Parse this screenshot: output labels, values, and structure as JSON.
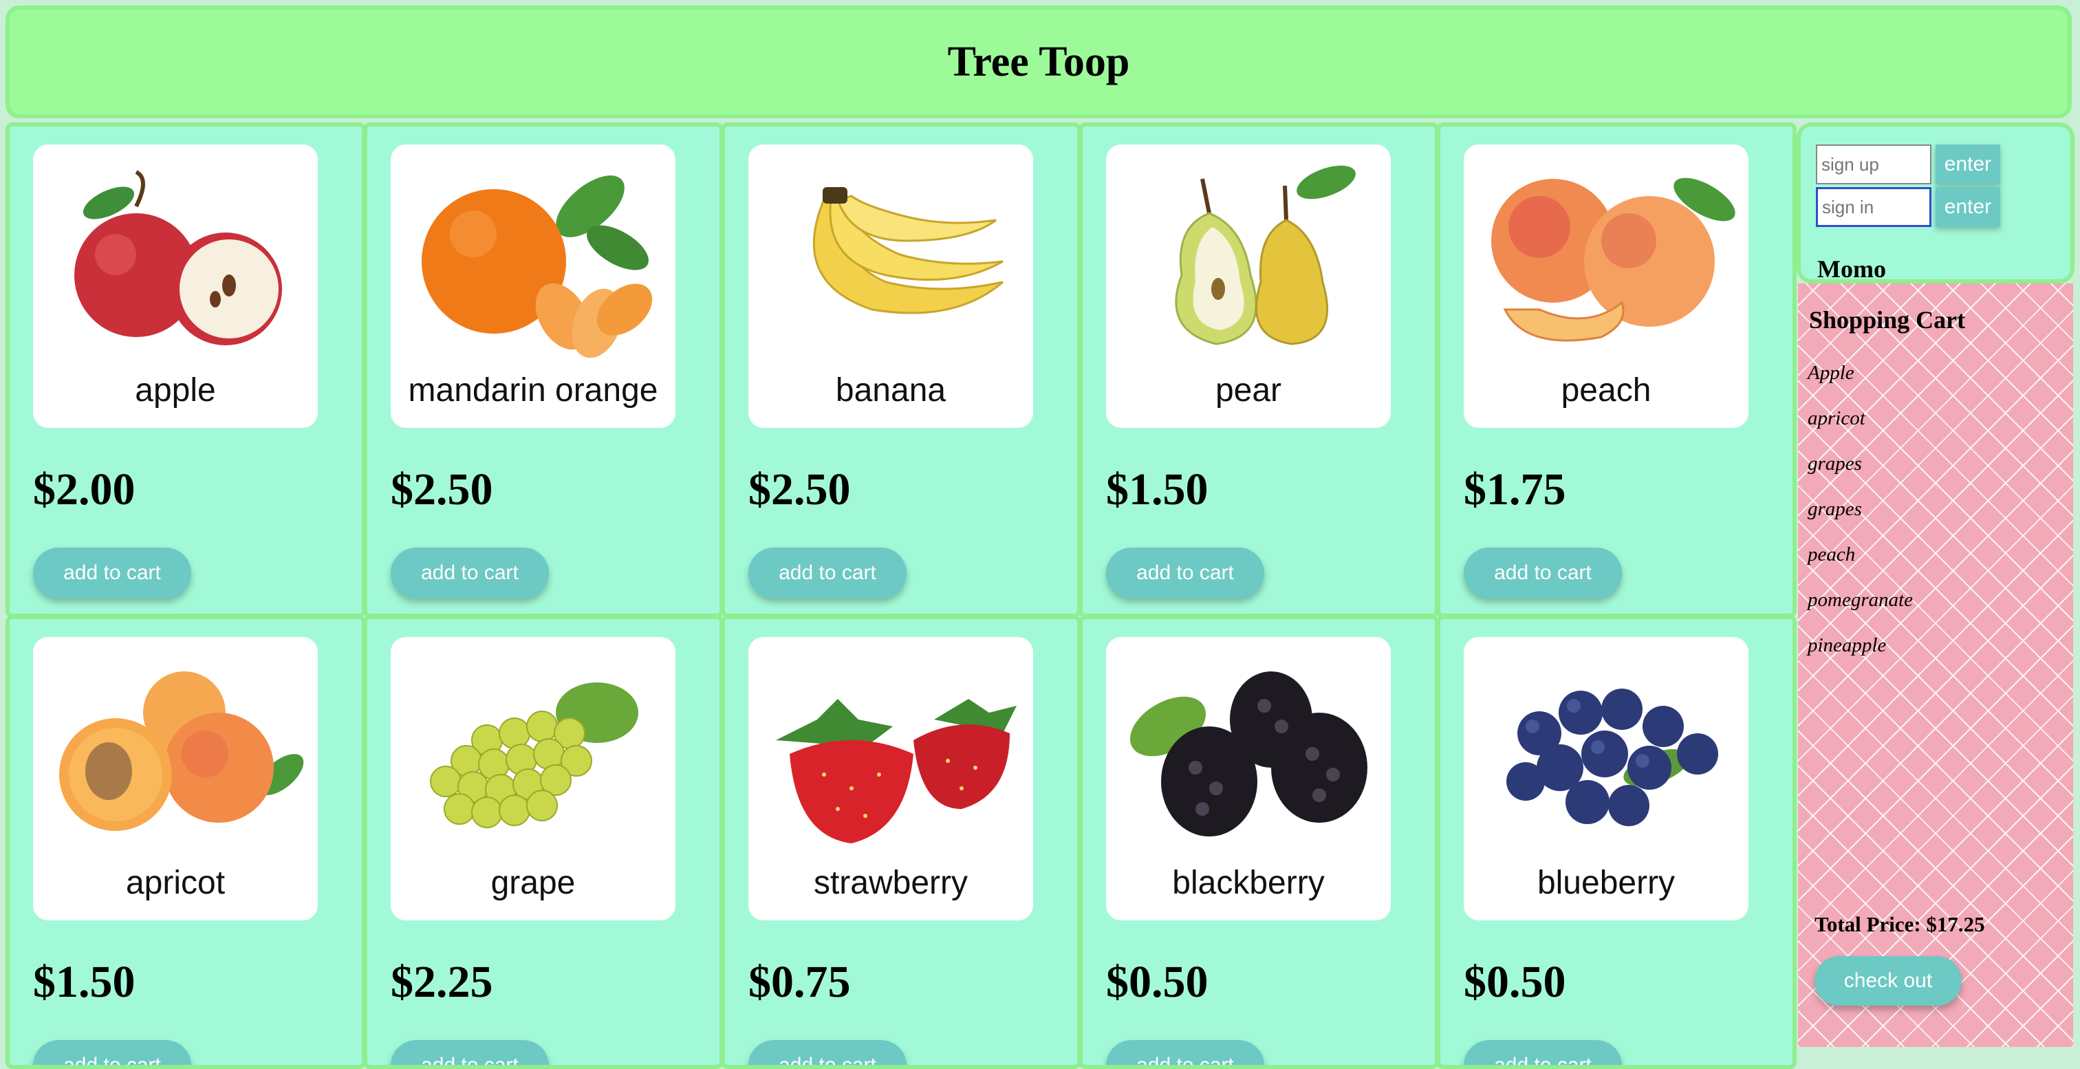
{
  "header": {
    "title": "Tree Toop"
  },
  "products": [
    {
      "name": "apple",
      "price": "$2.00",
      "button_label": "add to cart",
      "icon": "apple-image"
    },
    {
      "name": "mandarin orange",
      "price": "$2.50",
      "button_label": "add to cart",
      "icon": "mandarin-orange-image"
    },
    {
      "name": "banana",
      "price": "$2.50",
      "button_label": "add to cart",
      "icon": "banana-image"
    },
    {
      "name": "pear",
      "price": "$1.50",
      "button_label": "add to cart",
      "icon": "pear-image"
    },
    {
      "name": "peach",
      "price": "$1.75",
      "button_label": "add to cart",
      "icon": "peach-image"
    },
    {
      "name": "apricot",
      "price": "$1.50",
      "button_label": "add to cart",
      "icon": "apricot-image"
    },
    {
      "name": "grape",
      "price": "$2.25",
      "button_label": "add to cart",
      "icon": "grape-image"
    },
    {
      "name": "strawberry",
      "price": "$0.75",
      "button_label": "add to cart",
      "icon": "strawberry-image"
    },
    {
      "name": "blackberry",
      "price": "$0.50",
      "button_label": "add to cart",
      "icon": "blackberry-image"
    },
    {
      "name": "blueberry",
      "price": "$0.50",
      "button_label": "add to cart",
      "icon": "blueberry-image"
    }
  ],
  "auth": {
    "signup_placeholder": "sign up",
    "signin_placeholder": "sign in",
    "enter_label": "enter",
    "username": "Momo"
  },
  "cart": {
    "title": "Shopping Cart",
    "items": [
      "Apple",
      "apricot",
      "grapes",
      "grapes",
      "peach",
      "pomegranate",
      "pineapple"
    ],
    "total": "Total Price: $17.25",
    "checkout_label": "check out"
  },
  "colors": {
    "header_bg": "#9cfa98",
    "cell_bg": "#a2f9d8",
    "button": "#6cc9c3",
    "cart_bg": "#f2a9b8"
  }
}
